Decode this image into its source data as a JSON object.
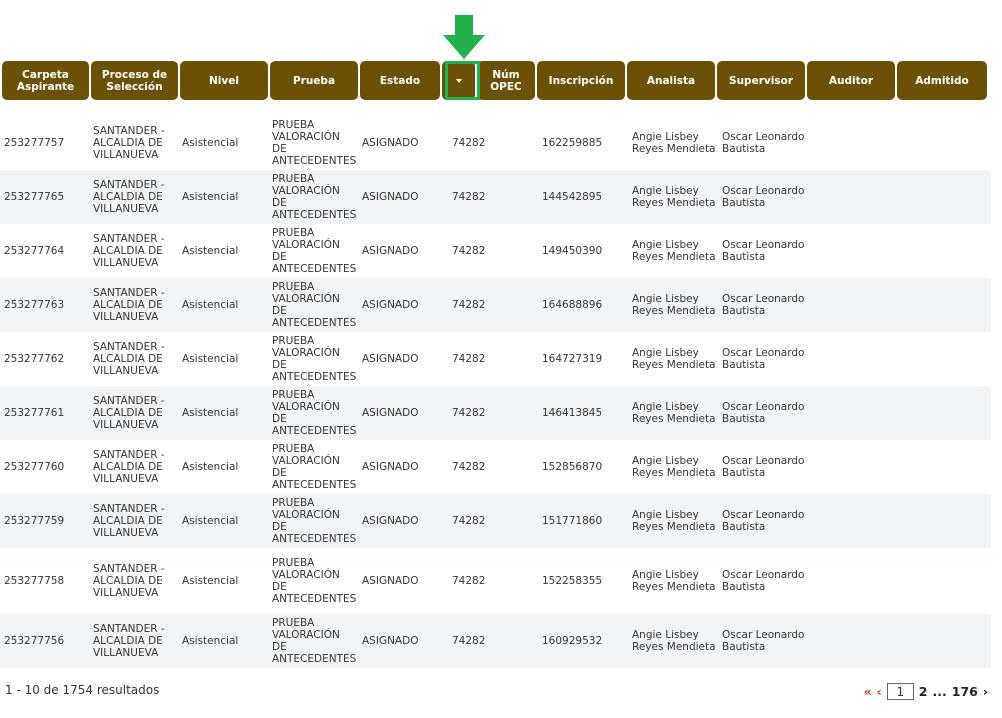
{
  "table": {
    "columns": [
      {
        "key": "carpeta",
        "label": "Carpeta Aspirante"
      },
      {
        "key": "proceso",
        "label": "Proceso de Selección"
      },
      {
        "key": "nivel",
        "label": "Nivel"
      },
      {
        "key": "prueba",
        "label": "Prueba"
      },
      {
        "key": "estado",
        "label": "Estado"
      },
      {
        "key": "sort",
        "label": ""
      },
      {
        "key": "opec",
        "label": "Núm OPEC"
      },
      {
        "key": "inscripcion",
        "label": "Inscripción"
      },
      {
        "key": "analista",
        "label": "Analista"
      },
      {
        "key": "supervisor",
        "label": "Supervisor"
      },
      {
        "key": "auditor",
        "label": "Auditor"
      },
      {
        "key": "admitido",
        "label": "Admitido"
      }
    ],
    "sort_icon": "caret-down-icon",
    "rows": [
      {
        "carpeta": "253277757",
        "proceso": [
          "SANTANDER -",
          "ALCALDIA DE",
          "VILLANUEVA"
        ],
        "nivel": "Asistencial",
        "prueba": [
          "PRUEBA",
          "VALORACIÓN",
          "DE",
          "ANTECEDENTES"
        ],
        "estado": "ASIGNADO",
        "opec": "74282",
        "inscripcion": "162259885",
        "analista": [
          "Angie Lisbey",
          "Reyes Mendieta"
        ],
        "supervisor": [
          "Oscar Leonardo",
          "Bautista"
        ],
        "auditor": "",
        "admitido": ""
      },
      {
        "carpeta": "253277765",
        "proceso": [
          "SANTANDER -",
          "ALCALDIA DE",
          "VILLANUEVA"
        ],
        "nivel": "Asistencial",
        "prueba": [
          "PRUEBA",
          "VALORACIÓN",
          "DE",
          "ANTECEDENTES"
        ],
        "estado": "ASIGNADO",
        "opec": "74282",
        "inscripcion": "144542895",
        "analista": [
          "Angie Lisbey",
          "Reyes Mendieta"
        ],
        "supervisor": [
          "Oscar Leonardo",
          "Bautista"
        ],
        "auditor": "",
        "admitido": ""
      },
      {
        "carpeta": "253277764",
        "proceso": [
          "SANTANDER -",
          "ALCALDIA DE",
          "VILLANUEVA"
        ],
        "nivel": "Asistencial",
        "prueba": [
          "PRUEBA",
          "VALORACIÓN",
          "DE",
          "ANTECEDENTES"
        ],
        "estado": "ASIGNADO",
        "opec": "74282",
        "inscripcion": "149450390",
        "analista": [
          "Angie Lisbey",
          "Reyes Mendieta"
        ],
        "supervisor": [
          "Oscar Leonardo",
          "Bautista"
        ],
        "auditor": "",
        "admitido": ""
      },
      {
        "carpeta": "253277763",
        "proceso": [
          "SANTANDER -",
          "ALCALDIA DE",
          "VILLANUEVA"
        ],
        "nivel": "Asistencial",
        "prueba": [
          "PRUEBA",
          "VALORACIÓN",
          "DE",
          "ANTECEDENTES"
        ],
        "estado": "ASIGNADO",
        "opec": "74282",
        "inscripcion": "164688896",
        "analista": [
          "Angie Lisbey",
          "Reyes Mendieta"
        ],
        "supervisor": [
          "Oscar Leonardo",
          "Bautista"
        ],
        "auditor": "",
        "admitido": ""
      },
      {
        "carpeta": "253277762",
        "proceso": [
          "SANTANDER -",
          "ALCALDIA DE",
          "VILLANUEVA"
        ],
        "nivel": "Asistencial",
        "prueba": [
          "PRUEBA",
          "VALORACIÓN",
          "DE",
          "ANTECEDENTES"
        ],
        "estado": "ASIGNADO",
        "opec": "74282",
        "inscripcion": "164727319",
        "analista": [
          "Angie Lisbey",
          "Reyes Mendieta"
        ],
        "supervisor": [
          "Oscar Leonardo",
          "Bautista"
        ],
        "auditor": "",
        "admitido": ""
      },
      {
        "carpeta": "253277761",
        "proceso": [
          "SANTANDER -",
          "ALCALDIA DE",
          "VILLANUEVA"
        ],
        "nivel": "Asistencial",
        "prueba": [
          "PRUEBA",
          "VALORACIÓN",
          "DE",
          "ANTECEDENTES"
        ],
        "estado": "ASIGNADO",
        "opec": "74282",
        "inscripcion": "146413845",
        "analista": [
          "Angie Lisbey",
          "Reyes Mendieta"
        ],
        "supervisor": [
          "Oscar Leonardo",
          "Bautista"
        ],
        "auditor": "",
        "admitido": ""
      },
      {
        "carpeta": "253277760",
        "proceso": [
          "SANTANDER -",
          "ALCALDIA DE",
          "VILLANUEVA"
        ],
        "nivel": "Asistencial",
        "prueba": [
          "PRUEBA",
          "VALORACIÓN",
          "DE",
          "ANTECEDENTES"
        ],
        "estado": "ASIGNADO",
        "opec": "74282",
        "inscripcion": "152856870",
        "analista": [
          "Angie Lisbey",
          "Reyes Mendieta"
        ],
        "supervisor": [
          "Oscar Leonardo",
          "Bautista"
        ],
        "auditor": "",
        "admitido": ""
      },
      {
        "carpeta": "253277759",
        "proceso": [
          "SANTANDER -",
          "ALCALDIA DE",
          "VILLANUEVA"
        ],
        "nivel": "Asistencial",
        "prueba": [
          "PRUEBA",
          "VALORACIÓN",
          "DE",
          "ANTECEDENTES"
        ],
        "estado": "ASIGNADO",
        "opec": "74282",
        "inscripcion": "151771860",
        "analista": [
          "Angie Lisbey",
          "Reyes Mendieta"
        ],
        "supervisor": [
          "Oscar Leonardo",
          "Bautista"
        ],
        "auditor": "",
        "admitido": ""
      },
      {
        "carpeta": "253277758",
        "proceso": [
          "SANTANDER -",
          "ALCALDIA DE",
          "VILLANUEVA"
        ],
        "nivel": "Asistencial",
        "prueba": [
          "PRUEBA",
          "VALORACIÓN",
          "DE",
          "ANTECEDENTES"
        ],
        "estado": "ASIGNADO",
        "opec": "74282",
        "inscripcion": "152258355",
        "analista": [
          "Angie Lisbey",
          "Reyes Mendieta"
        ],
        "supervisor": [
          "Oscar Leonardo",
          "Bautista"
        ],
        "auditor": "",
        "admitido": ""
      },
      {
        "carpeta": "253277756",
        "proceso": [
          "SANTANDER -",
          "ALCALDIA DE",
          "VILLANUEVA"
        ],
        "nivel": "Asistencial",
        "prueba": [
          "PRUEBA",
          "VALORACIÓN",
          "DE",
          "ANTECEDENTES"
        ],
        "estado": "ASIGNADO",
        "opec": "74282",
        "inscripcion": "160929532",
        "analista": [
          "Angie Lisbey",
          "Reyes Mendieta"
        ],
        "supervisor": [
          "Oscar Leonardo",
          "Bautista"
        ],
        "auditor": "",
        "admitido": ""
      }
    ]
  },
  "footer": {
    "results_text": "1 - 10 de 1754 resultados",
    "pager": {
      "first": "«",
      "prev": "‹",
      "current_page": "1",
      "next_page": "2",
      "dots": "...",
      "last_page": "176",
      "next": "›"
    }
  },
  "annotation": {
    "arrow_color": "#22b14c",
    "highlight": "sort-button"
  },
  "colors": {
    "header_bg": "#6b5106",
    "header_text": "#ffffff",
    "alt_row": "#f2f5f8",
    "pager_red": "#c0392b"
  }
}
